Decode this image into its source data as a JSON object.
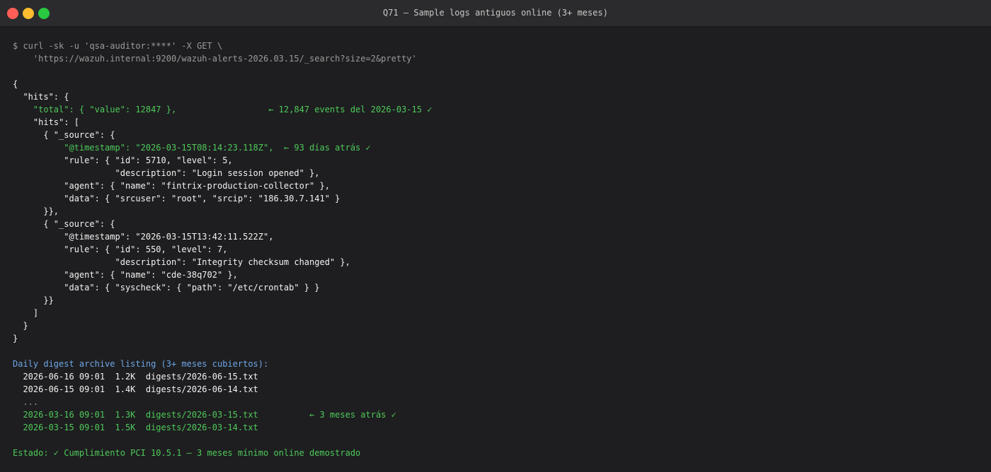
{
  "window": {
    "title": "Q71 — Sample logs antiguos online (3+ meses)"
  },
  "terminal": {
    "lines": [
      {
        "text": "$ curl -sk -u 'qsa-auditor:****' -X GET \\",
        "color": "gray"
      },
      {
        "text": "    'https://wazuh.internal:9200/wazuh-alerts-2026.03.15/_search?size=2&pretty'",
        "color": "gray"
      },
      {
        "text": "",
        "color": "white"
      },
      {
        "text": "{",
        "color": "white"
      },
      {
        "text": "  \"hits\": {",
        "color": "white"
      },
      {
        "text": "    \"total\": { \"value\": 12847 },                  ← 12,847 events del 2026-03-15 ✓",
        "color": "green"
      },
      {
        "text": "    \"hits\": [",
        "color": "white"
      },
      {
        "text": "      { \"_source\": {",
        "color": "white"
      },
      {
        "text": "          \"@timestamp\": \"2026-03-15T08:14:23.118Z\",  ← 93 días atrás ✓",
        "color": "green"
      },
      {
        "text": "          \"rule\": { \"id\": 5710, \"level\": 5,",
        "color": "white"
      },
      {
        "text": "                    \"description\": \"Login session opened\" },",
        "color": "white"
      },
      {
        "text": "          \"agent\": { \"name\": \"fintrix-production-collector\" },",
        "color": "white"
      },
      {
        "text": "          \"data\": { \"srcuser\": \"root\", \"srcip\": \"186.30.7.141\" }",
        "color": "white"
      },
      {
        "text": "      }},",
        "color": "white"
      },
      {
        "text": "      { \"_source\": {",
        "color": "white"
      },
      {
        "text": "          \"@timestamp\": \"2026-03-15T13:42:11.522Z\",",
        "color": "white"
      },
      {
        "text": "          \"rule\": { \"id\": 550, \"level\": 7,",
        "color": "white"
      },
      {
        "text": "                    \"description\": \"Integrity checksum changed\" },",
        "color": "white"
      },
      {
        "text": "          \"agent\": { \"name\": \"cde-38q702\" },",
        "color": "white"
      },
      {
        "text": "          \"data\": { \"syscheck\": { \"path\": \"/etc/crontab\" } }",
        "color": "white"
      },
      {
        "text": "      }}",
        "color": "white"
      },
      {
        "text": "    ]",
        "color": "white"
      },
      {
        "text": "  }",
        "color": "white"
      },
      {
        "text": "}",
        "color": "white"
      },
      {
        "text": "",
        "color": "white"
      },
      {
        "text": "Daily digest archive listing (3+ meses cubiertos):",
        "color": "blue"
      },
      {
        "text": "  2026-06-16 09:01  1.2K  digests/2026-06-15.txt",
        "color": "white"
      },
      {
        "text": "  2026-06-15 09:01  1.4K  digests/2026-06-14.txt",
        "color": "white"
      },
      {
        "text": "  ...",
        "color": "gray"
      },
      {
        "text": "  2026-03-16 09:01  1.3K  digests/2026-03-15.txt          ← 3 meses atrás ✓",
        "color": "green"
      },
      {
        "text": "  2026-03-15 09:01  1.5K  digests/2026-03-14.txt",
        "color": "green"
      },
      {
        "text": "",
        "color": "white"
      },
      {
        "text": "Estado: ✓ Cumplimiento PCI 10.5.1 — 3 meses mínimo online demostrado",
        "color": "green"
      }
    ]
  },
  "colors": {
    "green": "#4ec95a",
    "blue": "#6ea6e6",
    "gray": "#9a9a9a",
    "white": "#f2f2f2",
    "background": "#1e1e20",
    "titlebar": "#2b2b2d"
  }
}
